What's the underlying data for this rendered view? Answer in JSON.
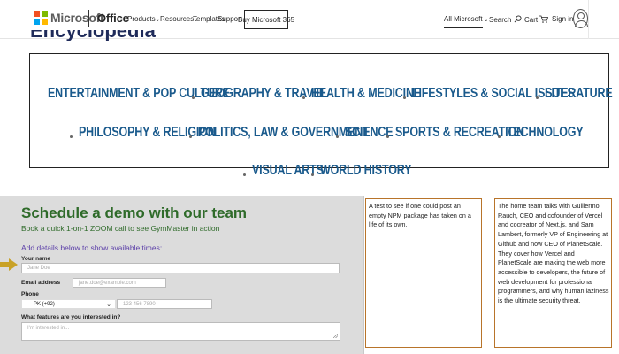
{
  "header": {
    "brand": "Microsoft",
    "product": "Office",
    "nav": [
      {
        "label": "Products",
        "icon": "chevron-down-icon"
      },
      {
        "label": "Resources",
        "icon": "chevron-down-icon"
      },
      {
        "label": "Templates",
        "icon": ""
      },
      {
        "label": "Support",
        "icon": ""
      }
    ],
    "buy_label": "Buy Microsoft 365",
    "all_microsoft": "All Microsoft",
    "search": "Search",
    "cart": "Cart",
    "signin": "Sign in",
    "logo_colors": [
      "#f25022",
      "#7fba00",
      "#00a4ef",
      "#ffb900"
    ]
  },
  "topics": {
    "cut_heading": "Encyclopedia",
    "items": [
      "ENTERTAINMENT & POP CULTURE",
      "GEOGRAPHY & TRAVEL",
      "HEALTH & MEDICINE",
      "LIFESTYLES & SOCIAL ISSUES",
      "LITERATURE",
      "PHILOSOPHY & RELIGION",
      "POLITICS, LAW & GOVERNMENT",
      "SCIENCE",
      "SPORTS & RECREATION",
      "TECHNOLOGY",
      "VISUAL ARTS",
      "WORLD HISTORY"
    ]
  },
  "demo": {
    "title": "Schedule a demo with our team",
    "subtitle": "Book a quick 1-on-1 ZOOM call to see GymMaster in action",
    "add_details": "Add details below to show available times:",
    "name_label": "Your name",
    "name_placeholder": "Jane Doe",
    "email_label": "Email address",
    "email_placeholder": "jane.doe@example.com",
    "phone_label": "Phone",
    "country_value": "PK (+92)",
    "phone_placeholder": "123 456 7890",
    "features_label": "What features are you interested in?",
    "features_placeholder": "I'm interested in...",
    "accent_color": "#2f6b2a",
    "arrow_color": "#c9a227"
  },
  "articles": [
    {
      "text": "A test to see if one could post an empty NPM package has taken on a life of its own."
    },
    {
      "text": "The home team talks with Guillermo Rauch, CEO and cofounder of Vercel and cocreator of Next.js, and Sam Lambert, formerly VP of Engineering at Github and now CEO of PlanetScale. They cover how Vercel and PlanetScale are making the web more accessible to developers, the future of web development for professional programmers, and why human laziness is the ultimate security threat."
    }
  ]
}
